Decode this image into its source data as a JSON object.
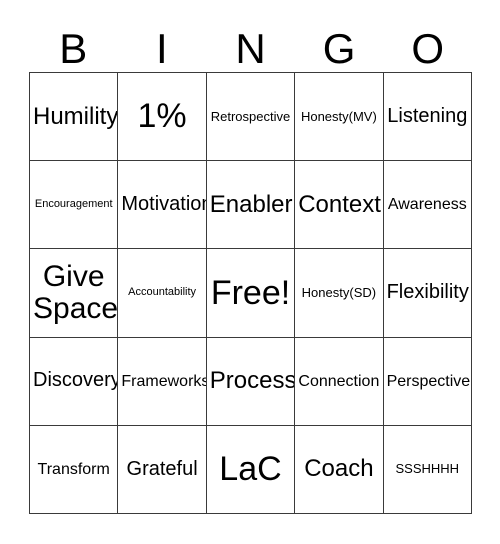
{
  "card": {
    "title": "BINGO",
    "header_letters": [
      "B",
      "I",
      "N",
      "G",
      "O"
    ],
    "grid_line_color": "#3a3a3a",
    "background_color": "#ffffff",
    "text_color": "#000000",
    "columns": 5,
    "rows": 5,
    "cells": [
      {
        "text": "Humility",
        "size": "fs-xl"
      },
      {
        "text": "1%",
        "size": "fs-huge"
      },
      {
        "text": "Retrospective",
        "size": "fs-sm"
      },
      {
        "text": "Honesty(MV)",
        "size": "fs-sm"
      },
      {
        "text": "Listening",
        "size": "fs-lg"
      },
      {
        "text": "Encouragement",
        "size": "fs-xs"
      },
      {
        "text": "Motivation",
        "size": "fs-lg"
      },
      {
        "text": "Enabler",
        "size": "fs-xl"
      },
      {
        "text": "Context",
        "size": "fs-xl"
      },
      {
        "text": "Awareness",
        "size": "fs-md"
      },
      {
        "text": "Give\nSpace",
        "size": "fs-xxl"
      },
      {
        "text": "Accountability",
        "size": "fs-xs"
      },
      {
        "text": "Free!",
        "size": "fs-huge"
      },
      {
        "text": "Honesty(SD)",
        "size": "fs-sm"
      },
      {
        "text": "Flexibility",
        "size": "fs-lg"
      },
      {
        "text": "Discovery",
        "size": "fs-lg"
      },
      {
        "text": "Frameworks",
        "size": "fs-md"
      },
      {
        "text": "Process",
        "size": "fs-xl"
      },
      {
        "text": "Connection",
        "size": "fs-md"
      },
      {
        "text": "Perspective",
        "size": "fs-md"
      },
      {
        "text": "Transform",
        "size": "fs-md"
      },
      {
        "text": "Grateful",
        "size": "fs-lg"
      },
      {
        "text": "LaC",
        "size": "fs-huge"
      },
      {
        "text": "Coach",
        "size": "fs-xl"
      },
      {
        "text": "SSSHHHH",
        "size": "fs-sm"
      }
    ]
  }
}
